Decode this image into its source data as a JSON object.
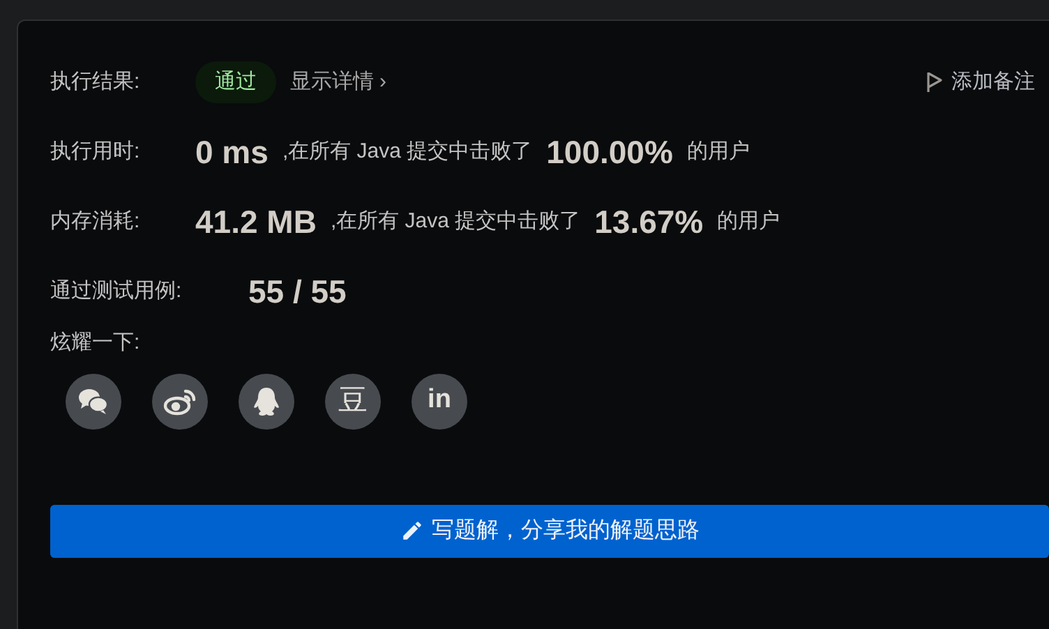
{
  "result": {
    "label": "执行结果:",
    "status": "通过",
    "details_link": "显示详情",
    "details_chevron": "›",
    "add_note": "添加备注"
  },
  "stats": [
    {
      "label": "执行用时:",
      "value": "0 ms",
      "middle": ",在所有 Java 提交中击败了",
      "percent": "100.00%",
      "suffix": "的用户"
    },
    {
      "label": "内存消耗:",
      "value": "41.2 MB",
      "middle": ",在所有 Java 提交中击败了",
      "percent": "13.67%",
      "suffix": "的用户"
    }
  ],
  "test_cases": {
    "label": "通过测试用例:",
    "value": "55 / 55"
  },
  "share": {
    "label": "炫耀一下:",
    "buttons": [
      {
        "kind": "wechat"
      },
      {
        "kind": "weibo"
      },
      {
        "kind": "qq"
      },
      {
        "kind": "douban",
        "glyph": "豆"
      },
      {
        "kind": "linkedin",
        "glyph": "in"
      }
    ]
  },
  "write_solution_button": "写题解，分享我的解题思路"
}
